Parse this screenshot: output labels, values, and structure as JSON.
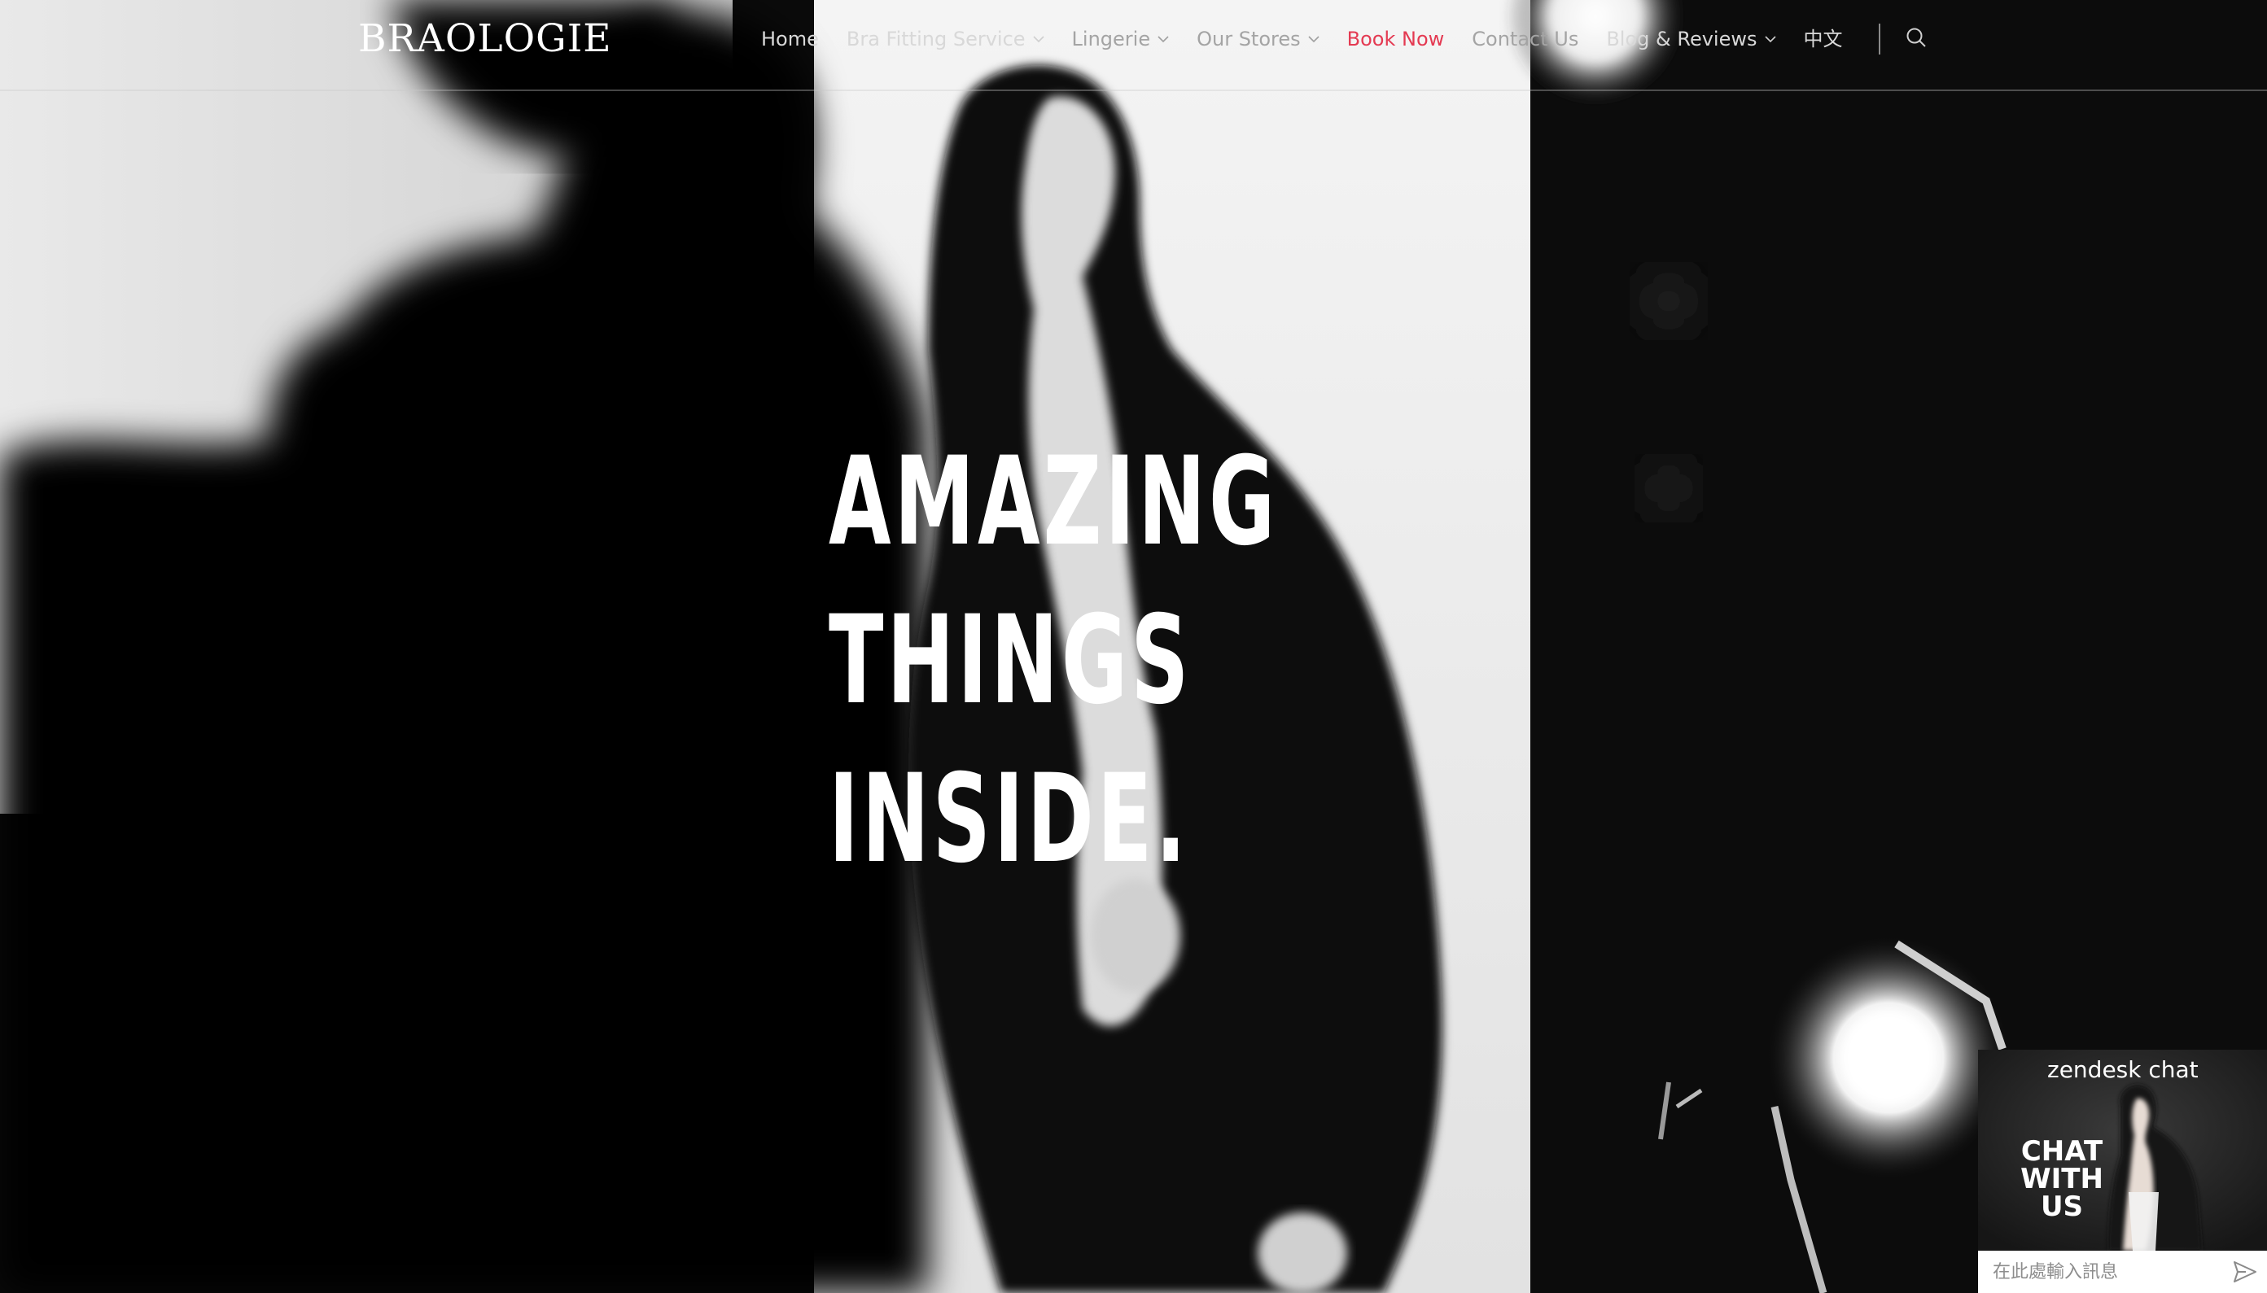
{
  "site": {
    "logo": "BRAOLOGIE"
  },
  "nav": {
    "items": [
      {
        "label": "Home",
        "has_dropdown": false,
        "color": "#d8d8d8"
      },
      {
        "label": "Bra Fitting Service",
        "has_dropdown": true,
        "color": "#d8d8d8"
      },
      {
        "label": "Lingerie",
        "has_dropdown": true,
        "color": "#a4a4a4"
      },
      {
        "label": "Our Stores",
        "has_dropdown": true,
        "color": "#a4a4a4"
      },
      {
        "label": "Book Now",
        "has_dropdown": false,
        "color": "#e43a52"
      },
      {
        "label": "Contact Us",
        "has_dropdown": false,
        "color": "#a4a4a4"
      },
      {
        "label": "Blog & Reviews",
        "has_dropdown": true,
        "color": "#d8d8d8"
      },
      {
        "label": "中文",
        "has_dropdown": false,
        "color": "#d8d8d8"
      }
    ],
    "search_icon": "search-icon"
  },
  "hero": {
    "headline_lines": [
      "AMAZING",
      "THINGS",
      "INSIDE."
    ]
  },
  "chat_widget": {
    "brand": "zendesk chat",
    "cta_lines": [
      "CHAT",
      "WITH US"
    ],
    "input_placeholder": "在此處輸入訊息",
    "send_icon": "send-icon"
  },
  "colors": {
    "accent": "#e43a52",
    "background": "#0b0b0b",
    "text": "#ffffff"
  }
}
